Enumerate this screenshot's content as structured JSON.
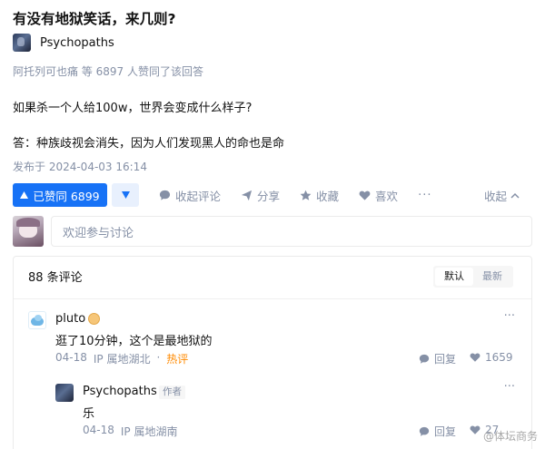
{
  "question": {
    "title": "有没有地狱笑话，来几则?"
  },
  "author": {
    "name": "Psychopaths"
  },
  "agree_line": "阿托列可也痛 等 6897 人赞同了该回答",
  "answer": {
    "line1": "如果杀一个人给100w，世界会变成什么样子?",
    "line2": "答：种族歧视会消失，因为人们发现黑人的命也是命",
    "published": "发布于 2024-04-03 16:14"
  },
  "actions": {
    "upvote_label": "已赞同 6899",
    "downvote_icon": "triangle-down-icon",
    "comment_label": "收起评论",
    "share_label": "分享",
    "favorite_label": "收藏",
    "like_label": "喜欢",
    "more": "···",
    "collapse_label": "收起"
  },
  "comment_input": {
    "placeholder": "欢迎参与讨论"
  },
  "comments_panel": {
    "count_label": "88 条评论",
    "sort_options": [
      "默认",
      "最新"
    ],
    "active_sort": "默认",
    "comments": [
      {
        "name": "pluto",
        "text": "逛了10分钟，这个是最地狱的",
        "date": "04-18",
        "location": "IP 属地湖北",
        "hot_tag": "热评",
        "reply_label": "回复",
        "likes": "1659",
        "more": "···"
      },
      {
        "name": "Psychopaths",
        "author_tag": "作者",
        "text": "乐",
        "date": "04-18",
        "location": "IP 属地湖南",
        "reply_label": "回复",
        "likes": "27",
        "more": "···"
      }
    ]
  },
  "watermark": "@体坛商务"
}
